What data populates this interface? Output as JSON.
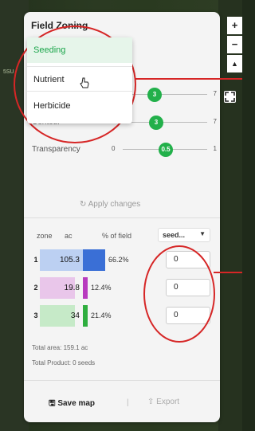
{
  "map": {
    "side_label": "5SU"
  },
  "panel": {
    "title": "Field Zoning",
    "dropdown": {
      "items": [
        "Seeding",
        "Nutrient",
        "Herbicide"
      ],
      "selected": "Seeding",
      "hovered": "Nutrient"
    },
    "sliders": [
      {
        "label": "",
        "min": "1",
        "max": "7",
        "value": "3",
        "fraction": 0.33
      },
      {
        "label": "Contour",
        "min": "1",
        "max": "7",
        "value": "3",
        "fraction": 0.33
      },
      {
        "label": "Transparency",
        "min": "0",
        "max": "1",
        "value": "0.5",
        "fraction": 0.5
      }
    ],
    "apply_label": "↻ Apply changes",
    "table": {
      "headers": {
        "zone": "zone",
        "ac": "ac",
        "pct": "% of field"
      },
      "product_select": "seed...",
      "rows": [
        {
          "zone": "1",
          "ac": "105.3",
          "pct": "66.2%",
          "rate": "0",
          "color_light": "#bcd0f2",
          "color_dark": "#3a6fd6",
          "fraction": 0.662
        },
        {
          "zone": "2",
          "ac": "19.8",
          "pct": "12.4%",
          "rate": "0",
          "color_light": "#e9c6ea",
          "color_dark": "#b83bbf",
          "fraction": 0.124
        },
        {
          "zone": "3",
          "ac": "34",
          "pct": "21.4%",
          "rate": "0",
          "color_light": "#c6eac8",
          "color_dark": "#2fae3f",
          "fraction": 0.214
        }
      ]
    },
    "total_area": "Total area: 159.1 ac",
    "total_product": "Total Product: 0 seeds",
    "save_label": "Save map",
    "separator": "|",
    "export_label": "Export"
  },
  "map_controls": {
    "zoom_in": "+",
    "zoom_out": "−",
    "compass": "▲"
  },
  "colors": {
    "accent": "#22b04a",
    "annotation": "#d62626"
  }
}
